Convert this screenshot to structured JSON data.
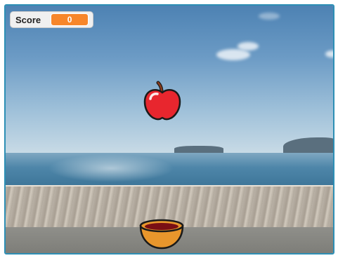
{
  "score": {
    "label": "Score",
    "value": "0"
  },
  "sprites": {
    "apple": "apple-sprite",
    "bowl": "bowl-sprite"
  },
  "colors": {
    "stage_border": "#2d8fb5",
    "score_badge": "#f7862a",
    "apple_red": "#e8262e",
    "bowl_orange": "#e8962c"
  }
}
